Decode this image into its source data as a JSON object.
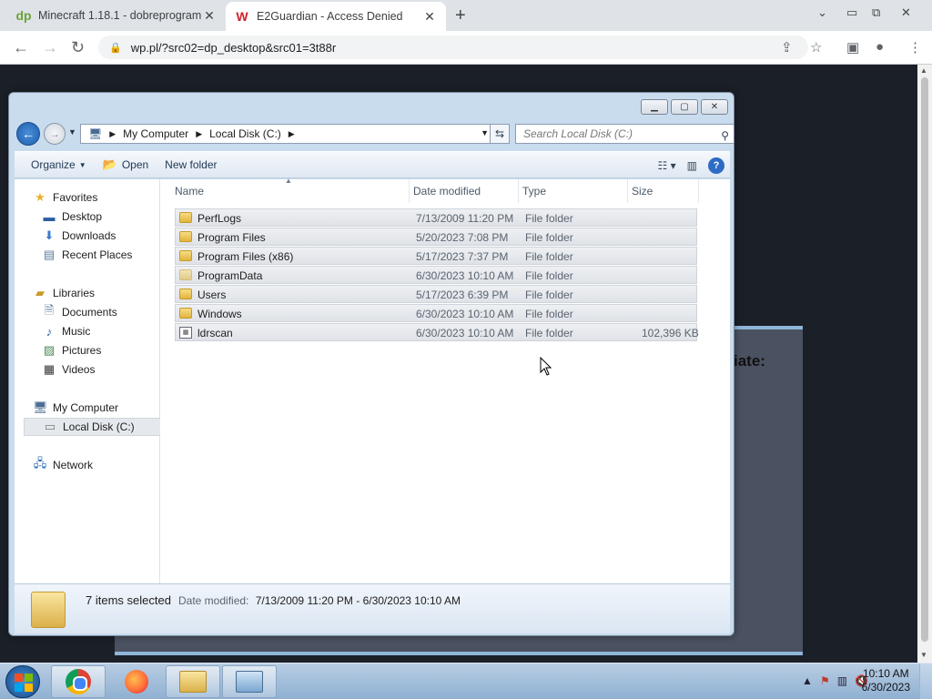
{
  "browser": {
    "tabs": [
      {
        "favicon": "dp",
        "title": "Minecraft 1.18.1 - dobreprogram",
        "close": "✕"
      },
      {
        "favicon": "W",
        "title": "E2Guardian - Access Denied",
        "close": "✕"
      }
    ],
    "new_tab": "+",
    "url": "wp.pl/?src02=dp_desktop&src01=3t88r",
    "page_fragment": "iate:"
  },
  "explorer": {
    "breadcrumb": [
      "My Computer",
      "Local Disk (C:)"
    ],
    "search_placeholder": "Search Local Disk (C:)",
    "toolbar": {
      "organize": "Organize",
      "open": "Open",
      "new_folder": "New folder"
    },
    "nav": {
      "favorites": "Favorites",
      "desktop": "Desktop",
      "downloads": "Downloads",
      "recent_places": "Recent Places",
      "libraries": "Libraries",
      "documents": "Documents",
      "music": "Music",
      "pictures": "Pictures",
      "videos": "Videos",
      "my_computer": "My Computer",
      "local_disk": "Local Disk (C:)",
      "network": "Network"
    },
    "columns": {
      "name": "Name",
      "date_modified": "Date modified",
      "type": "Type",
      "size": "Size"
    },
    "files": [
      {
        "name": "PerfLogs",
        "date": "7/13/2009 11:20 PM",
        "type": "File folder",
        "size": ""
      },
      {
        "name": "Program Files",
        "date": "5/20/2023 7:08 PM",
        "type": "File folder",
        "size": ""
      },
      {
        "name": "Program Files (x86)",
        "date": "5/17/2023 7:37 PM",
        "type": "File folder",
        "size": ""
      },
      {
        "name": "ProgramData",
        "date": "6/30/2023 10:10 AM",
        "type": "File folder",
        "size": ""
      },
      {
        "name": "Users",
        "date": "5/17/2023 6:39 PM",
        "type": "File folder",
        "size": ""
      },
      {
        "name": "Windows",
        "date": "6/30/2023 10:10 AM",
        "type": "File folder",
        "size": ""
      },
      {
        "name": "ldrscan",
        "date": "6/30/2023 10:10 AM",
        "type": "File folder",
        "size": "102,396 KB"
      }
    ],
    "details": {
      "selected": "7 items selected",
      "date_label": "Date modified:",
      "date_range": "7/13/2009 11:20 PM - 6/30/2023 10:10 AM"
    }
  },
  "taskbar": {
    "time": "10:10 AM",
    "date": "6/30/2023"
  }
}
